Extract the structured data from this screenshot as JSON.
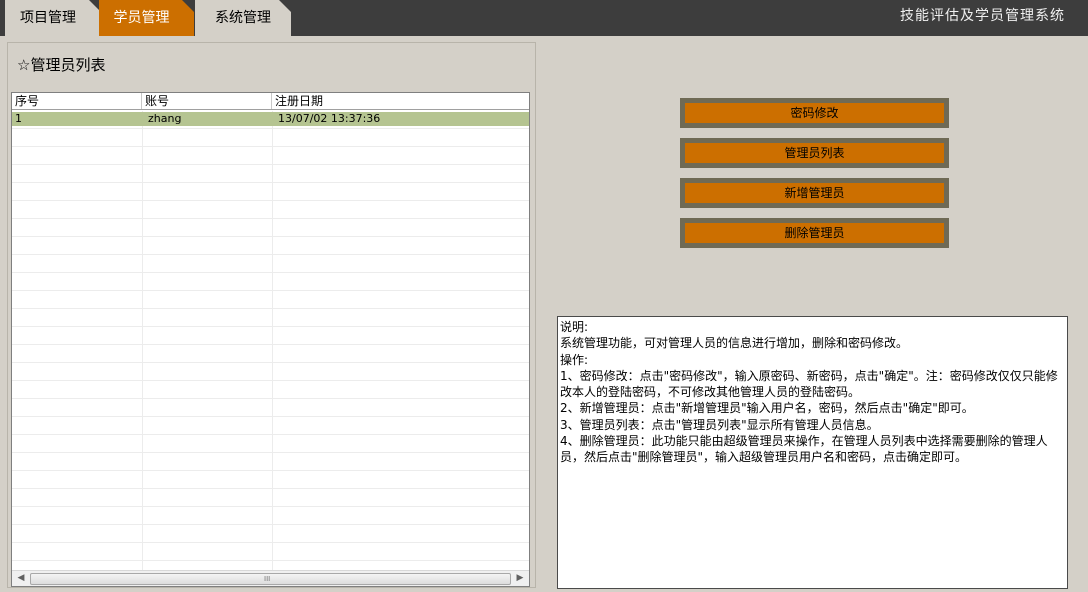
{
  "app_title": "技能评估及学员管理系统",
  "tabs": [
    {
      "label": "项目管理"
    },
    {
      "label": "学员管理"
    },
    {
      "label": "系统管理"
    }
  ],
  "panel": {
    "title": "☆管理员列表",
    "columns": [
      "序号",
      "账号",
      "注册日期"
    ],
    "rows": [
      {
        "index": "1",
        "account": "zhang",
        "date": "13/07/02 13:37:36"
      }
    ],
    "scroll_grip": "III"
  },
  "buttons": {
    "change_password": "密码修改",
    "admin_list": "管理员列表",
    "add_admin": "新增管理员",
    "delete_admin": "删除管理员"
  },
  "description": {
    "lines": [
      "说明:",
      "系统管理功能，可对管理人员的信息进行增加，删除和密码修改。",
      "操作:",
      "1、密码修改：点击\"密码修改\"，输入原密码、新密码，点击\"确定\"。注：密码修改仅仅只能修改本人的登陆密码，不可修改其他管理人员的登陆密码。",
      "2、新增管理员：点击\"新增管理员\"输入用户名，密码，然后点击\"确定\"即可。",
      "3、管理员列表：点击\"管理员列表\"显示所有管理人员信息。",
      "4、删除管理员：此功能只能由超级管理员来操作，在管理人员列表中选择需要删除的管理人员，然后点击\"删除管理员\"，输入超级管理员用户名和密码，点击确定即可。"
    ]
  },
  "colors": {
    "accent": "#cc6f00",
    "topbar": "#3d3d3d",
    "selected_row": "#b5c491",
    "button_border": "#6f6a55"
  }
}
